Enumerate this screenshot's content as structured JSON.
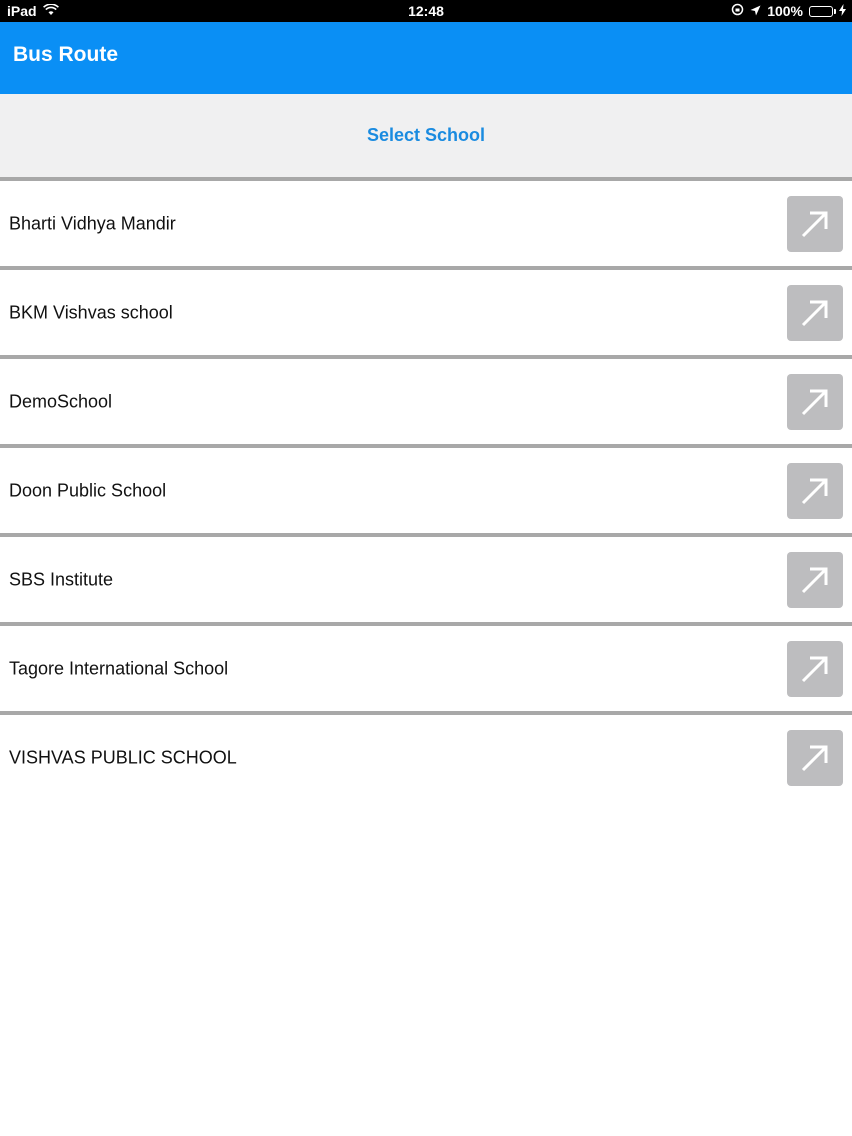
{
  "status_bar": {
    "device": "iPad",
    "time": "12:48",
    "battery": "100%",
    "battery_color": "#4cd964"
  },
  "nav": {
    "title": "Bus Route",
    "color": "#0a8ff5"
  },
  "header": {
    "title": "Select School",
    "color": "#1a8be0"
  },
  "schools": [
    {
      "name": "Bharti Vidhya Mandir",
      "icon": "arrow-up-right-icon"
    },
    {
      "name": "BKM Vishvas school",
      "icon": "arrow-up-right-icon"
    },
    {
      "name": "DemoSchool",
      "icon": "arrow-up-right-icon"
    },
    {
      "name": "Doon Public School",
      "icon": "arrow-up-right-icon"
    },
    {
      "name": "SBS Institute",
      "icon": "arrow-up-right-icon"
    },
    {
      "name": "Tagore International School",
      "icon": "arrow-up-right-icon"
    },
    {
      "name": "VISHVAS PUBLIC SCHOOL",
      "icon": "arrow-up-right-icon"
    }
  ]
}
